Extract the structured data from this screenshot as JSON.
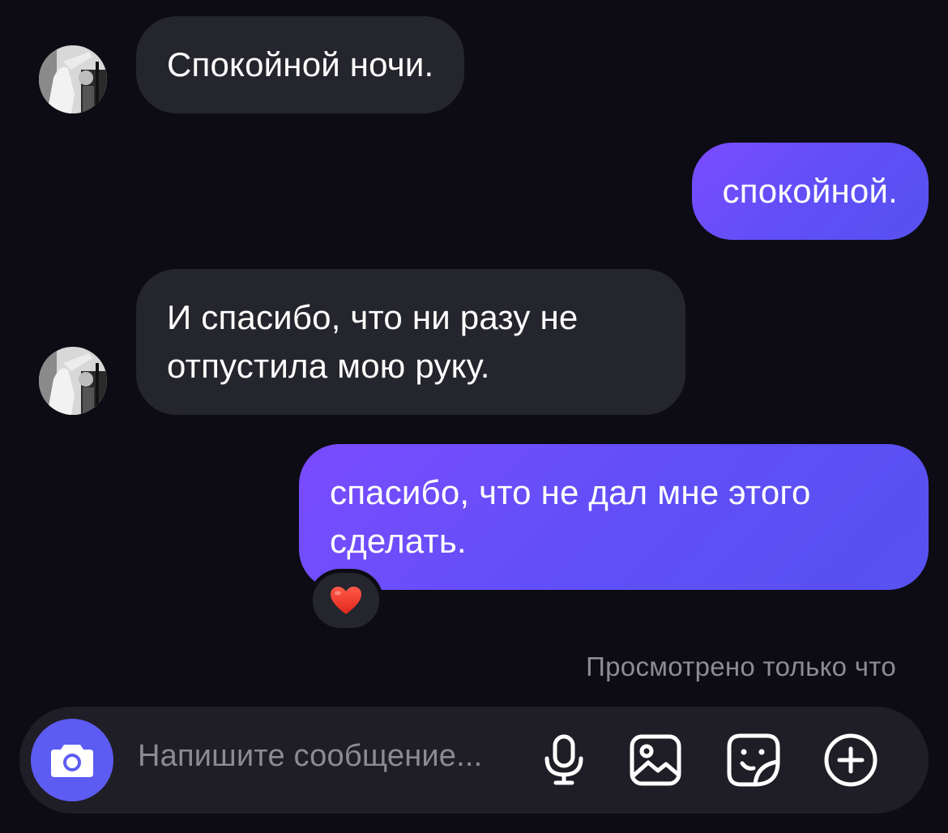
{
  "messages": [
    {
      "direction": "in",
      "text": "Спокойной ночи."
    },
    {
      "direction": "out",
      "text": "спокойной."
    },
    {
      "direction": "in",
      "text_line1": "И спасибо, что ни разу не",
      "text_line2": "отпустила мою руку."
    },
    {
      "direction": "out",
      "text_line1": "спасибо, что не дал мне этого",
      "text_line2": "сделать.",
      "reaction": "❤️"
    }
  ],
  "status": {
    "seen": "Просмотрено только что"
  },
  "composer": {
    "placeholder": "Напишите сообщение...",
    "icons": [
      "camera-icon",
      "microphone-icon",
      "gallery-icon",
      "sticker-icon",
      "plus-icon"
    ]
  },
  "colors": {
    "background": "#0d0c14",
    "incoming_bubble": "#25252d",
    "outgoing_bubble": "#6a4ef9",
    "accent": "#5d5cf2"
  }
}
